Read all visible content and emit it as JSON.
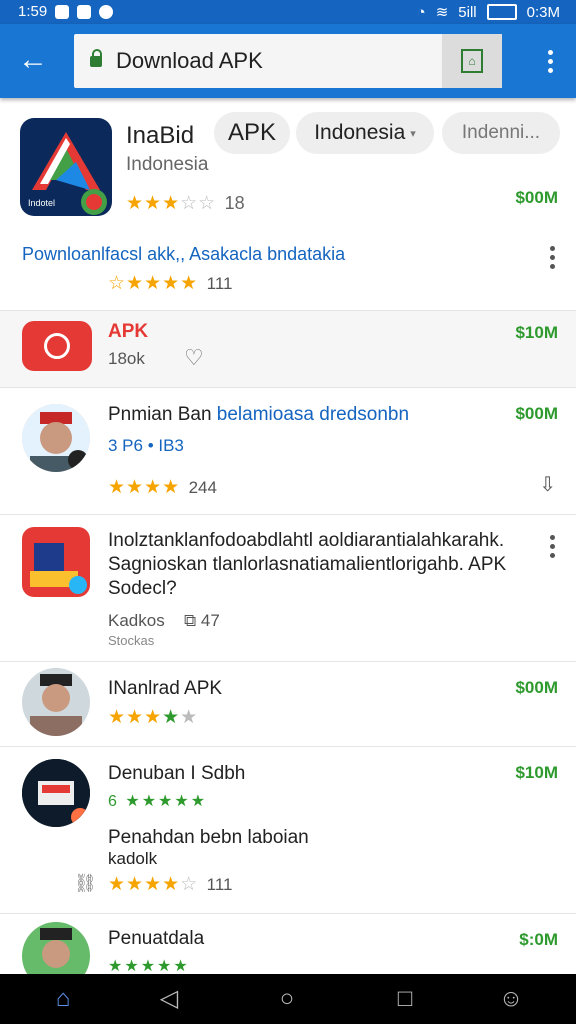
{
  "status_bar": {
    "time": "1:59",
    "battery_time": "0:3M",
    "signal": "5ill"
  },
  "toolbar": {
    "url": "Download APK"
  },
  "app": {
    "name": "InaBid",
    "chip_apk": "APK",
    "chip_country": "Indonesia",
    "chip_more": "Indenni...",
    "subtitle": "Indonesia",
    "rating": 3.5,
    "rating_count": "18",
    "price": "$00M",
    "icon_label": "Indotel"
  },
  "promo": {
    "title": "Pownloanlfacsl akk,, Asakacla bndatakia",
    "count": "111"
  },
  "highlight": {
    "title": "APK",
    "sub": "18ok",
    "price": "$10M"
  },
  "items": [
    {
      "title": "Pnmian Ban",
      "title_blue": "belamioasa dredsonbn",
      "line2": "3 P6 • IB3",
      "rating_count": "244",
      "price": "$00M"
    },
    {
      "title": "Inolztanklanfodoabdlahtl aoldiarantialahkarahk. Sagnioskan tlanlorlasnatiamalientlorigahb. APK Sodecl?",
      "line2": "Kadkos",
      "count": "47",
      "line3": "Stockas"
    },
    {
      "title": "INanlrad APK",
      "price": "$00M"
    },
    {
      "title": "Denuban I Sdbh",
      "sub": "Penahdan bebn laboian",
      "sub2": "kadolk",
      "rating_count": "111",
      "price": "$10M"
    },
    {
      "title": "Penuatdala",
      "price": "$:0M"
    }
  ],
  "icons": {
    "back": "arrow-left-icon",
    "lock": "lock-icon",
    "menu": "more-vert-icon",
    "heart": "heart-icon",
    "download": "download-icon",
    "link": "link-icon",
    "home": "home-icon",
    "nav_back": "triangle-back-icon",
    "nav_home": "circle-home-icon",
    "recents": "square-recents-icon",
    "profile": "profile-icon"
  },
  "colors": {
    "toolbar": "#1976d2",
    "status": "#1565c0",
    "price": "#2e9a2e",
    "star": "#f6a400",
    "accent_red": "#e53935"
  }
}
